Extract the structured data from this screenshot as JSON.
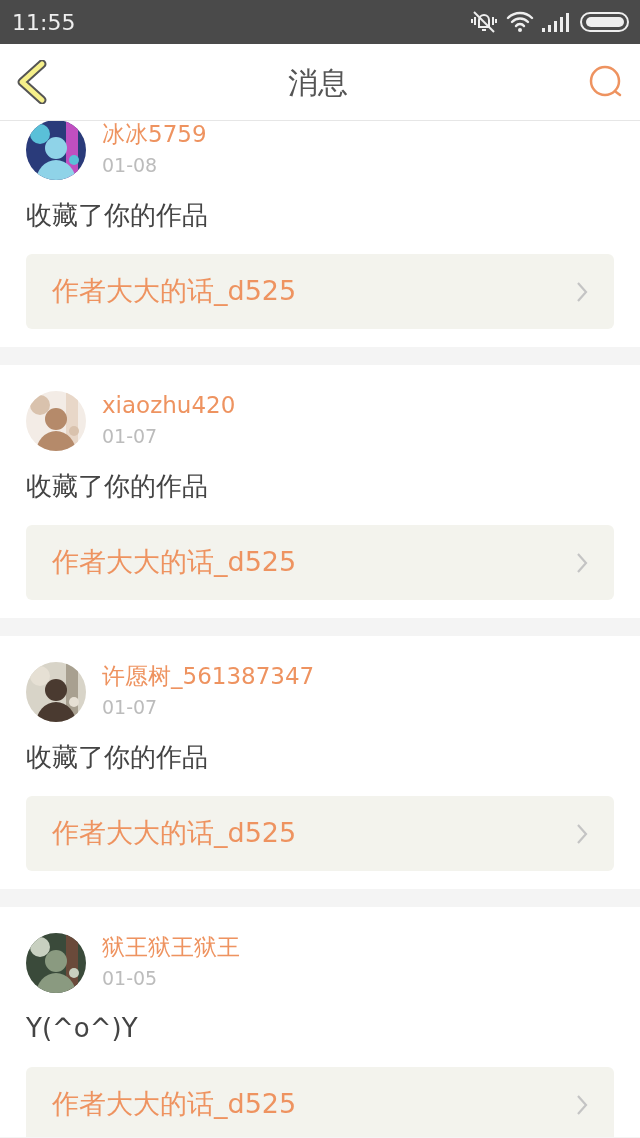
{
  "status_bar": {
    "time": "11:55"
  },
  "header": {
    "title": "消息"
  },
  "messages": [
    {
      "user": "冰冰5759",
      "date": "01-08",
      "text": "收藏了你的作品",
      "link": "作者大大的话_d525"
    },
    {
      "user": "xiaozhu420",
      "date": "01-07",
      "text": "收藏了你的作品",
      "link": "作者大大的话_d525"
    },
    {
      "user": "许愿树_561387347",
      "date": "01-07",
      "text": "收藏了你的作品",
      "link": "作者大大的话_d525"
    },
    {
      "user": "狱王狱王狱王",
      "date": "01-05",
      "text": "Y(^o^)Y",
      "link": "作者大大的话_d525"
    }
  ]
}
